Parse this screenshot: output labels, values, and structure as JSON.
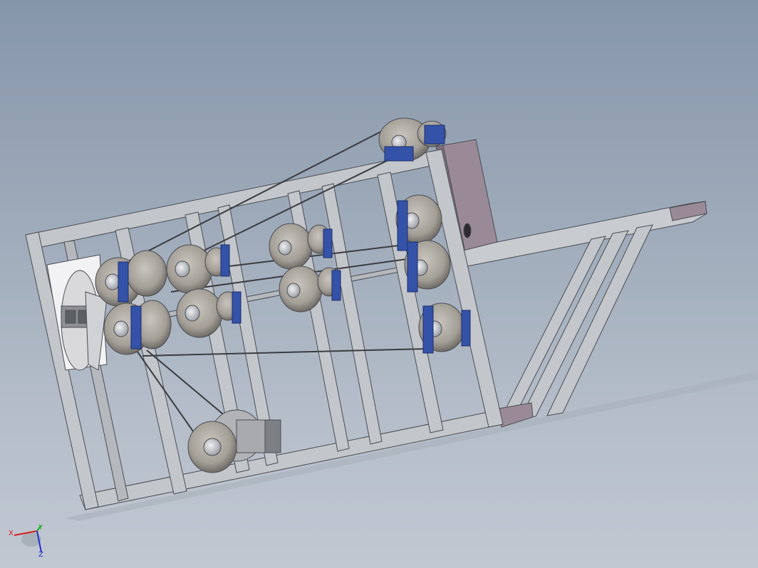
{
  "scene": {
    "colors": {
      "frame_fill": "#c3c6ca",
      "frame_stroke": "#4a4d52",
      "pulley_fill": "#a9a59e",
      "pulley_hub": "#d8d8da",
      "bearing_blue": "#3452a8",
      "motor_plate": "#9a8a98",
      "belt": "#3a3c40"
    }
  },
  "triad": {
    "x_label": "X",
    "y_label": "Y",
    "z_label": "Z",
    "x_color": "#d42020",
    "y_color": "#20b020",
    "z_color": "#2030d0"
  }
}
